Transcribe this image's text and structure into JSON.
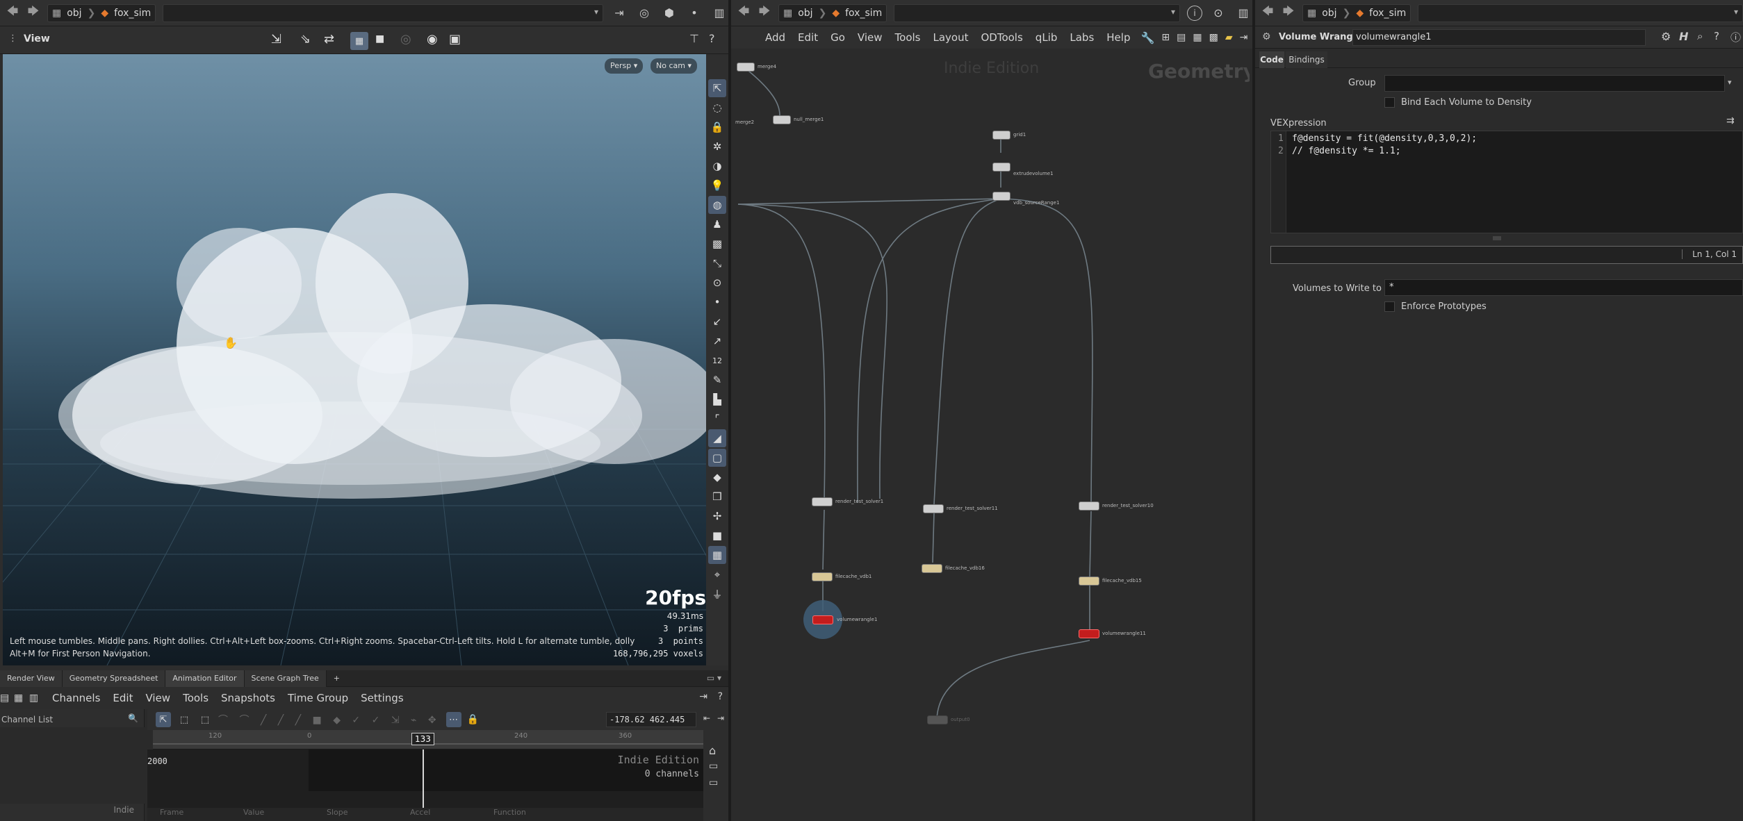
{
  "viewer": {
    "path": {
      "root": "obj",
      "node": "fox_sim"
    },
    "title": "View",
    "persp": "Persp",
    "cam": "No cam",
    "fps": "20fps",
    "ms": "49.31ms",
    "prims": "3  prims",
    "points": "3  points",
    "voxels": "168,796,295 voxels",
    "help_line1": "Left mouse tumbles. Middle pans. Right dollies. Ctrl+Alt+Left box-zooms. Ctrl+Right zooms. Spacebar-Ctrl-Left tilts. Hold L for alternate tumble, dolly, and zoom.",
    "help_line2": "Alt+M for First Person Navigation."
  },
  "bottom": {
    "tabs": [
      "Render View",
      "Geometry Spreadsheet",
      "Animation Editor",
      "Scene Graph Tree"
    ],
    "active_tab": 2,
    "menu": [
      "Channels",
      "Edit",
      "View",
      "Tools",
      "Snapshots",
      "Time Group",
      "Settings"
    ],
    "channel_list": "Channel List",
    "range": "-178.62 462.445",
    "ruler": [
      "120",
      "0",
      "133",
      "240",
      "360"
    ],
    "frame_marker": "133",
    "value_2000": "2000",
    "indie": "Indie Edition",
    "channels": "0 channels",
    "indie_small": "Indie",
    "footer_cols": [
      "Frame",
      "Value",
      "Slope",
      "Accel",
      "Function"
    ]
  },
  "network": {
    "path": {
      "root": "obj",
      "node": "fox_sim"
    },
    "menu": [
      "Add",
      "Edit",
      "Go",
      "View",
      "Tools",
      "Layout",
      "ODTools",
      "qLib",
      "Labs",
      "Help"
    ],
    "watermark": "Indie Edition",
    "context": "Geometry",
    "nodes": [
      {
        "label": "merge4",
        "style": "w"
      },
      {
        "label": "null_merge1",
        "style": "w"
      },
      {
        "label": "merge2",
        "style": "w"
      },
      {
        "label": "grid1",
        "style": "w"
      },
      {
        "label": "extrudevolume1",
        "style": "w"
      },
      {
        "label": "vdb_sourceRange1",
        "style": "w"
      },
      {
        "label": "render_test_solver1",
        "style": "w"
      },
      {
        "label": "render_test_solver11",
        "style": "w"
      },
      {
        "label": "render_test_solver10",
        "style": "w"
      },
      {
        "label": "filecache_vdb1",
        "style": "y"
      },
      {
        "label": "filecache_vdb16",
        "style": "y"
      },
      {
        "label": "filecache_vdb15",
        "style": "y"
      },
      {
        "label": "volumewrangle1",
        "style": "r"
      },
      {
        "label": "volumewrangle11",
        "style": "r"
      },
      {
        "label": "output0",
        "style": "w"
      }
    ]
  },
  "params": {
    "path": {
      "root": "obj",
      "node": "fox_sim"
    },
    "node_type": "Volume Wrangle",
    "node_name": "volumewrangle1",
    "tabs": [
      "Code",
      "Bindings"
    ],
    "group_label": "Group",
    "group_value": "",
    "bind_label": "Bind Each Volume to Density",
    "vex_label": "VEXpression",
    "code": [
      {
        "n": "1",
        "text": "f@density = fit(@density,0,3,0,2);"
      },
      {
        "n": "2",
        "text": "// f@density *= 1.1;"
      }
    ],
    "cursor": "Ln 1, Col 1",
    "write_label": "Volumes to Write to",
    "write_value": "*",
    "enforce_label": "Enforce Prototypes"
  }
}
